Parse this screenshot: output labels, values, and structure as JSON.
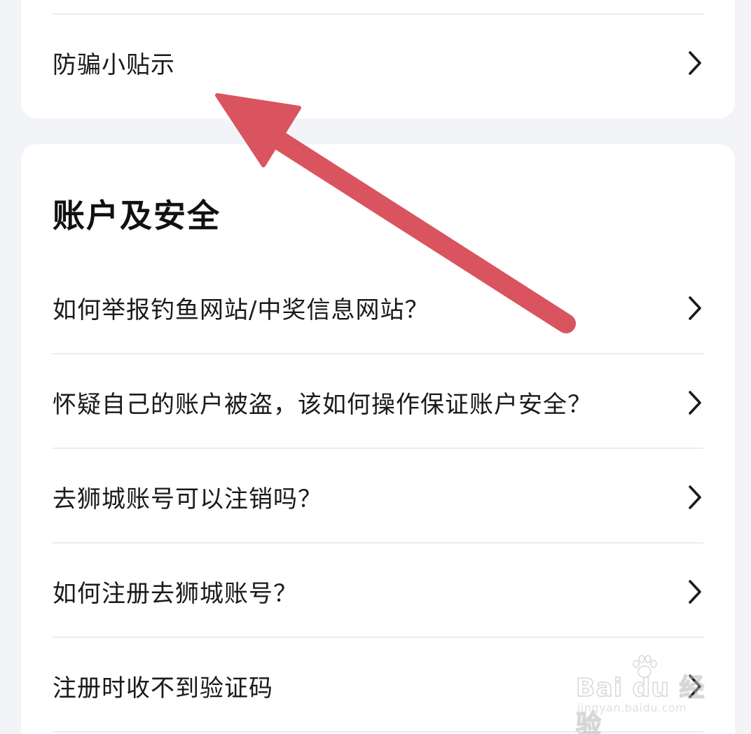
{
  "top_card": {
    "item_label": "防骗小贴示"
  },
  "account_section": {
    "title": "账户及安全",
    "items": [
      {
        "label": "如何举报钓鱼网站/中奖信息网站？"
      },
      {
        "label": "怀疑自己的账户被盗，该如何操作保证账户安全？"
      },
      {
        "label": "去狮城账号可以注销吗？"
      },
      {
        "label": "如何注册去狮城账号？"
      },
      {
        "label": "注册时收不到验证码"
      }
    ]
  },
  "icons": {
    "row_chevron": "chevron-right-icon",
    "annotation": "red-arrow-annotation"
  },
  "colors": {
    "page_background": "#f3f4f8",
    "card_background": "#ffffff",
    "annotation_arrow": "#d9545e",
    "divider": "#ececf0"
  },
  "watermark": {
    "logo_text": "Bai du 经验",
    "url": "jingyan.baidu.com"
  }
}
